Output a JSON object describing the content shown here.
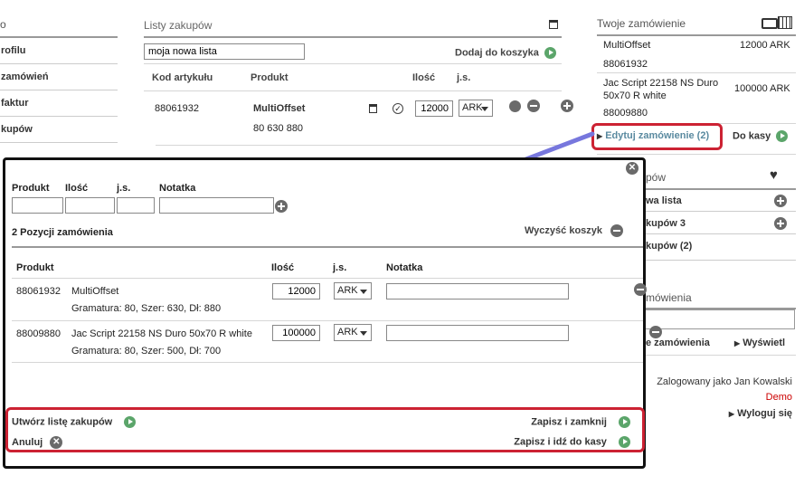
{
  "left_nav": {
    "header": "o",
    "items": [
      "rofilu",
      "zamówień",
      "faktur",
      "kupów"
    ]
  },
  "shopping_list": {
    "title": "Listy zakupów",
    "list_name_value": "moja nowa lista",
    "add_to_cart": "Dodaj do koszyka",
    "columns": {
      "code": "Kod artykułu",
      "product": "Produkt",
      "qty": "Ilość",
      "unit": "j.s."
    },
    "row": {
      "code": "88061932",
      "product": "MultiOffset",
      "product_code": "80 630 880",
      "qty": "12000",
      "unit": "ARK"
    }
  },
  "your_order": {
    "title": "Twoje zamówienie",
    "items": [
      {
        "name": "MultiOffset",
        "code": "88061932",
        "qty": "12000 ARK"
      },
      {
        "name": "Jac Script 22158 NS Duro 50x70 R white",
        "code": "88009880",
        "qty": "100000 ARK"
      }
    ],
    "edit_order": "Edytuj zamówienie (2)",
    "checkout": "Do kasy"
  },
  "sidebar_lists": {
    "header": "pów",
    "items": [
      "wa lista",
      "kupów 3",
      "kupów (2)"
    ]
  },
  "sidebar_orders": {
    "header": "mówienia",
    "link_left": "e zamówienia",
    "link_right": "Wyświetl"
  },
  "user": {
    "logged_in": "Zalogowany jako Jan Kowalski",
    "demo": "Demo",
    "logout": "Wyloguj się"
  },
  "popup": {
    "form_labels": {
      "product": "Produkt",
      "qty": "Ilość",
      "unit": "j.s.",
      "note": "Notatka"
    },
    "count_title": "2 Pozycji zamówienia",
    "clear_cart": "Wyczyść koszyk",
    "columns": {
      "product": "Produkt",
      "qty": "Ilość",
      "unit": "j.s.",
      "note": "Notatka"
    },
    "rows": [
      {
        "code": "88061932",
        "name": "MultiOffset",
        "spec": "Gramatura: 80, Szer: 630, Dł: 880",
        "qty": "12000",
        "unit": "ARK"
      },
      {
        "code": "88009880",
        "name": "Jac Script 22158 NS Duro 50x70 R white",
        "spec": "Gramatura: 80, Szer: 500, Dł: 700",
        "qty": "100000",
        "unit": "ARK"
      }
    ],
    "create_list": "Utwórz listę zakupów",
    "cancel": "Anuluj",
    "save_close": "Zapisz i zamknij",
    "save_checkout": "Zapisz i idź do kasy"
  },
  "colors": {
    "highlight": "#cc2233",
    "arrow": "#7777dd",
    "action_green": "#5ba56a",
    "demo_red": "#cc0000"
  }
}
